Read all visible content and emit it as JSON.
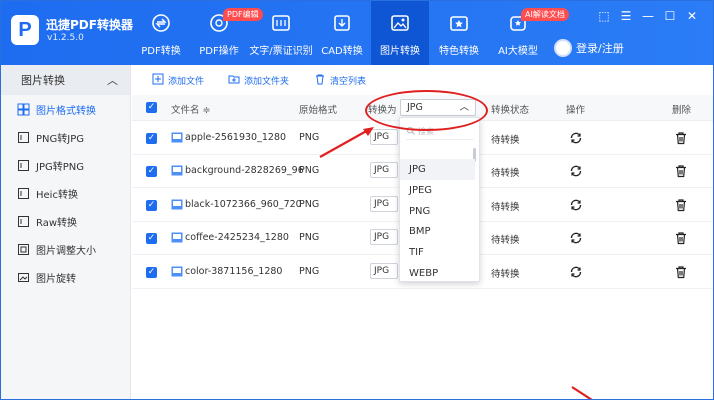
{
  "app": {
    "name": "迅捷PDF转换器",
    "version": "v1.2.5.0",
    "logo_letter": "P"
  },
  "nav": [
    {
      "label": "PDF转换",
      "icon": "pdf-convert-icon"
    },
    {
      "label": "PDF操作",
      "icon": "pdf-operate-icon",
      "badge": "PDF编辑"
    },
    {
      "label": "文字/票证识别",
      "icon": "ocr-icon"
    },
    {
      "label": "CAD转换",
      "icon": "cad-icon"
    },
    {
      "label": "图片转换",
      "icon": "image-convert-icon",
      "active": true
    },
    {
      "label": "特色转换",
      "icon": "special-convert-icon"
    },
    {
      "label": "AI大模型",
      "icon": "ai-model-icon",
      "badge": "AI解读文档"
    }
  ],
  "user": {
    "login_label": "登录/注册"
  },
  "window": {
    "skin": "⬚",
    "menu": "☰",
    "minimize": "—",
    "maximize": "☐",
    "close": "✕"
  },
  "sidebar": {
    "header": "图片转换",
    "items": [
      {
        "label": "图片格式转换",
        "active": true
      },
      {
        "label": "PNG转JPG"
      },
      {
        "label": "JPG转PNG"
      },
      {
        "label": "Heic转换"
      },
      {
        "label": "Raw转换"
      },
      {
        "label": "图片调整大小"
      },
      {
        "label": "图片旋转"
      }
    ]
  },
  "toolbar": {
    "add_file": "添加文件",
    "add_folder": "添加文件夹",
    "clear_list": "清空列表"
  },
  "table": {
    "headers": {
      "name": "文件名 ≑",
      "orig_format": "原始格式",
      "convert_to": "转换为",
      "status": "转换状态",
      "action": "操作",
      "delete": "删除"
    },
    "convert_to_value": "JPG",
    "rows": [
      {
        "name": "apple-2561930_1280",
        "format": "PNG",
        "target": "JPG",
        "status": "待转换"
      },
      {
        "name": "background-2828269_96",
        "format": "PNG",
        "target": "JPG",
        "status": "待转换"
      },
      {
        "name": "black-1072366_960_720",
        "format": "PNG",
        "target": "JPG",
        "status": "待转换"
      },
      {
        "name": "coffee-2425234_1280",
        "format": "PNG",
        "target": "JPG",
        "status": "待转换"
      },
      {
        "name": "color-3871156_1280",
        "format": "PNG",
        "target": "JPG",
        "status": "待转换"
      }
    ]
  },
  "dropdown": {
    "search_placeholder": "搜索",
    "options": [
      "JPG",
      "JPEG",
      "PNG",
      "BMP",
      "TIF",
      "WEBP"
    ],
    "highlighted": "JPG"
  },
  "colors": {
    "primary": "#1e6cf0",
    "annotation": "#e02020",
    "badge": "#ff4d4f"
  }
}
